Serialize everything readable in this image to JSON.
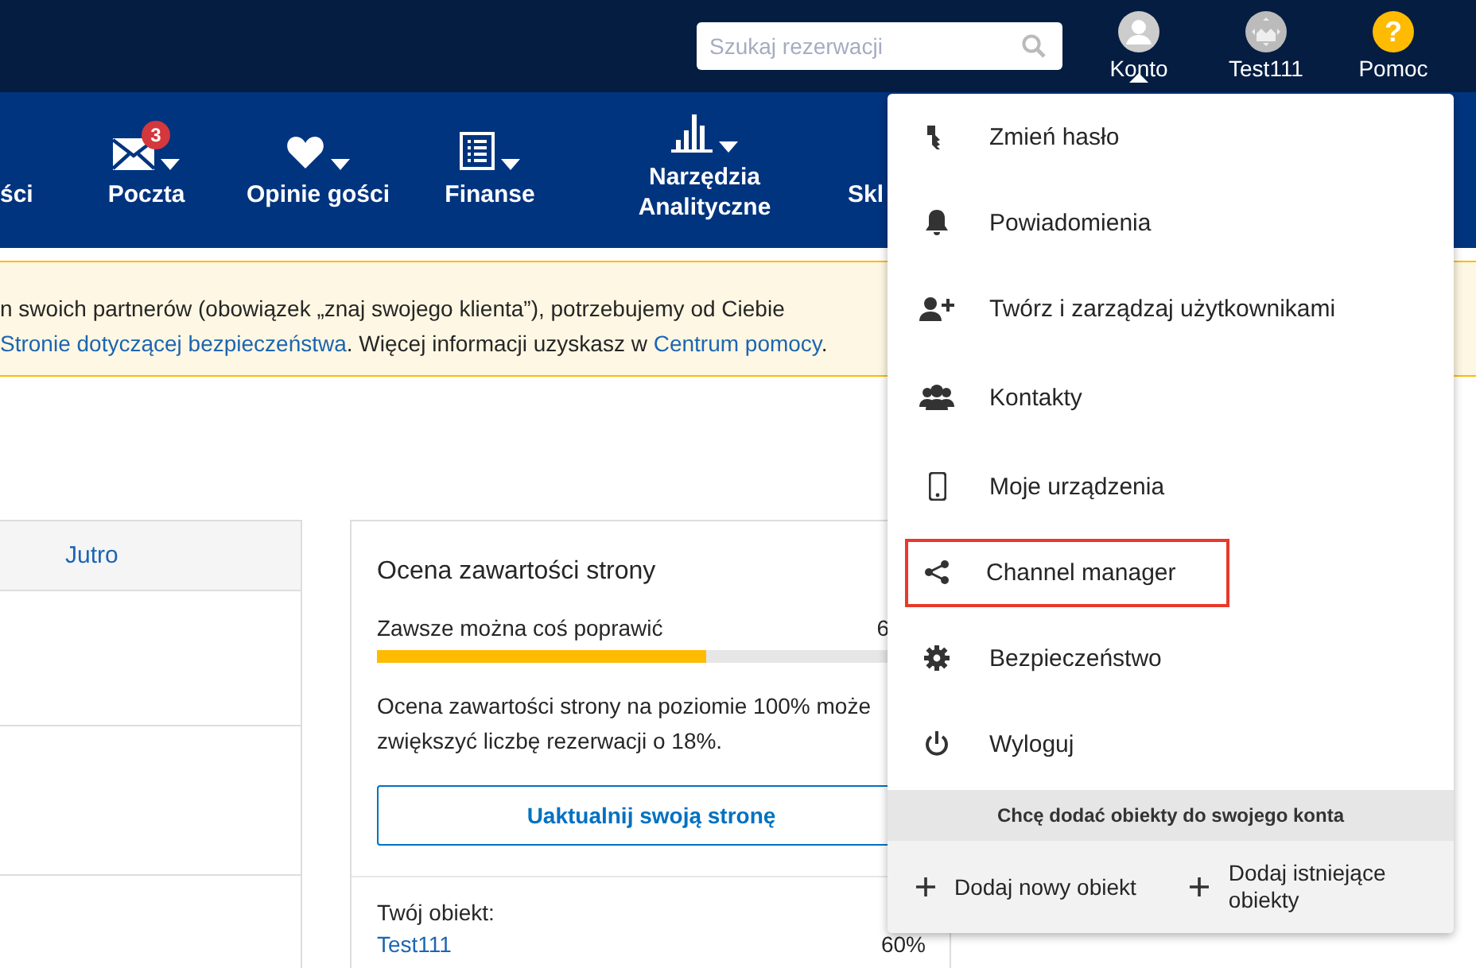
{
  "top_bar": {
    "search": {
      "placeholder": "Szukaj rezerwacji"
    },
    "actions": [
      {
        "kind": "account",
        "label": "Konto",
        "selected": true
      },
      {
        "kind": "property",
        "label": "Test111",
        "selected": false
      },
      {
        "kind": "help",
        "label": "Pomoc",
        "glyph": "?",
        "selected": false
      }
    ]
  },
  "nav": [
    {
      "kind": "none",
      "label": "ści",
      "caret": false
    },
    {
      "kind": "mail",
      "label": "Poczta",
      "badge": "3",
      "caret": true
    },
    {
      "kind": "heart",
      "label": "Opinie gości",
      "caret": true
    },
    {
      "kind": "list",
      "label": "Finanse",
      "caret": true
    },
    {
      "kind": "chart",
      "label": "Narzędzia Analityczne",
      "caret": true
    },
    {
      "kind": "none",
      "label": "Skl",
      "caret": false
    }
  ],
  "notice": {
    "line_1": "n swoich partnerów (obowiązek „znaj swojego klienta”), potrzebujemy od Ciebie",
    "line_2": [
      {
        "kind": "link",
        "text": "Stronie dotyczącej bezpieczeństwa"
      },
      {
        "kind": "text",
        "text": ". Więcej informacji uzyskasz w "
      },
      {
        "kind": "link",
        "text": "Centrum pomocy"
      },
      {
        "kind": "text",
        "text": "."
      }
    ]
  },
  "table": {
    "columns": [
      "Jutro"
    ]
  },
  "score_card": {
    "title": "Ocena zawartości strony",
    "progress": {
      "label": "Zawsze można coś poprawić",
      "reading": "6",
      "level": 0.6
    },
    "text_lines": [
      "Ocena zawartości strony na poziomie 100% może",
      "zwiększyć liczbę rezerwacji o 18%."
    ],
    "button": "Uaktualnij swoją stronę",
    "property_label": "Twój obiekt:",
    "property": {
      "name": "Test111",
      "score": "60%"
    }
  },
  "account_menu": {
    "items": [
      {
        "kind": "key",
        "label": "Zmień hasło",
        "highlighted": false
      },
      {
        "kind": "bell",
        "label": "Powiadomienia",
        "highlighted": false
      },
      {
        "kind": "userplus",
        "label": "Twórz i zarządzaj użytkownikami",
        "highlighted": false
      },
      {
        "kind": "users",
        "label": "Kontakty",
        "highlighted": false
      },
      {
        "kind": "phone",
        "label": "Moje urządzenia",
        "highlighted": false
      },
      {
        "kind": "share",
        "label": "Channel manager",
        "highlighted": true
      },
      {
        "kind": "gear",
        "label": "Bezpieczeństwo",
        "highlighted": false
      },
      {
        "kind": "power",
        "label": "Wyloguj",
        "highlighted": false
      }
    ],
    "footer_title": "Chcę dodać obiekty do swojego konta",
    "footer_actions": [
      "Dodaj nowy obiekt",
      "Dodaj istniejące obiekty"
    ]
  }
}
